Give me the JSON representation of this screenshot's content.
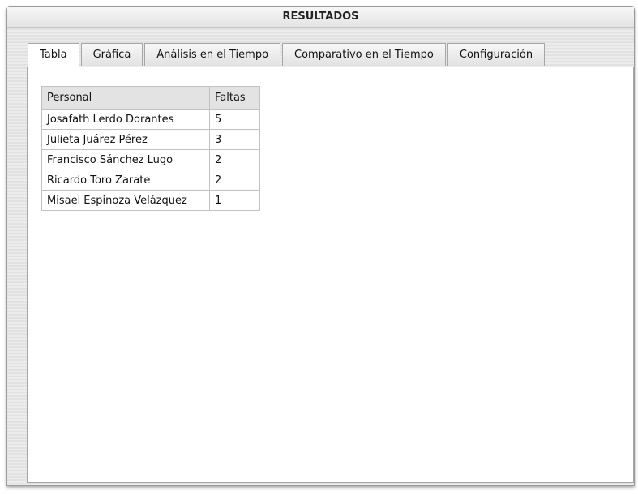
{
  "window": {
    "title": "RESULTADOS"
  },
  "tabs": [
    {
      "label": "Tabla",
      "active": true
    },
    {
      "label": "Gráfica",
      "active": false
    },
    {
      "label": "Análisis en el Tiempo",
      "active": false
    },
    {
      "label": "Comparativo en el Tiempo",
      "active": false
    },
    {
      "label": "Configuración",
      "active": false
    }
  ],
  "table": {
    "headers": [
      "Personal",
      "Faltas"
    ],
    "rows": [
      {
        "personal": "Josafath Lerdo Dorantes",
        "faltas": "5"
      },
      {
        "personal": "Julieta Juárez Pérez",
        "faltas": "3"
      },
      {
        "personal": "Francisco Sánchez Lugo",
        "faltas": "2"
      },
      {
        "personal": "Ricardo Toro Zarate",
        "faltas": "2"
      },
      {
        "personal": "Misael Espinoza Velázquez",
        "faltas": "1"
      }
    ]
  }
}
